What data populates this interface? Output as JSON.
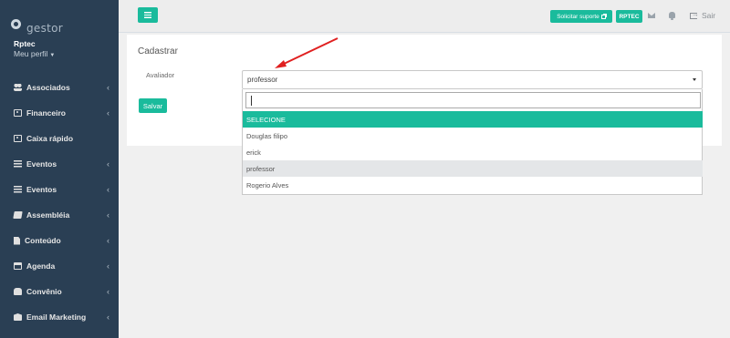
{
  "sidebar": {
    "logo_text": "gestor",
    "user_name": "Rptec",
    "profile_link": "Meu perfil",
    "items": [
      {
        "label": "Associados",
        "icon": "users-icon",
        "chevron": "‹"
      },
      {
        "label": "Financeiro",
        "icon": "money-icon",
        "chevron": "‹"
      },
      {
        "label": "Caixa rápido",
        "icon": "money-icon",
        "chevron": ""
      },
      {
        "label": "Eventos",
        "icon": "list-icon",
        "chevron": "‹"
      },
      {
        "label": "Eventos",
        "icon": "list-icon",
        "chevron": "‹"
      },
      {
        "label": "Assembléia",
        "icon": "book-icon",
        "chevron": "‹"
      },
      {
        "label": "Conteúdo",
        "icon": "file-icon",
        "chevron": "‹"
      },
      {
        "label": "Agenda",
        "icon": "calendar-icon",
        "chevron": "‹"
      },
      {
        "label": "Convênio",
        "icon": "handshake-icon",
        "chevron": "‹"
      },
      {
        "label": "Email Marketing",
        "icon": "envelope-open-icon",
        "chevron": "‹"
      }
    ]
  },
  "topbar": {
    "support_label": "Solicitar suporte",
    "company_label": "RPTEC",
    "signout_label": "Sair"
  },
  "form": {
    "title": "Cadastrar",
    "field_label": "Avaliador",
    "selected_value": "professor",
    "search_value": "",
    "options": [
      "SELECIONE",
      "Douglas filipo",
      "erick",
      "professor",
      "Rogerio Alves"
    ],
    "highlighted_index": 0,
    "selected_index": 3,
    "save_label": "Salvar"
  },
  "colors": {
    "sidebar_bg": "#2a3f54",
    "accent": "#1abb9c",
    "annotation_arrow": "#e02020"
  }
}
